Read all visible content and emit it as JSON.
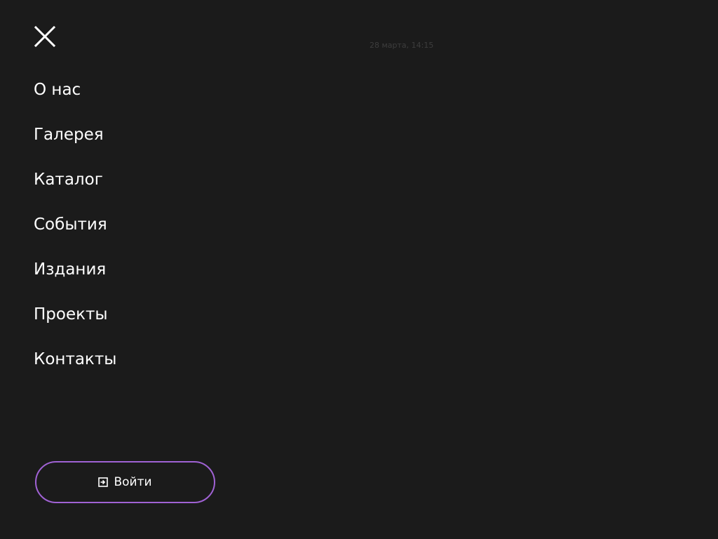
{
  "header": {
    "close_icon": "close-icon",
    "timestamp": "28 марта, 14:15",
    "timestamp_color": "#3d3d3d"
  },
  "menu": {
    "items": [
      {
        "label": "О нас"
      },
      {
        "label": "Галерея"
      },
      {
        "label": "Каталог"
      },
      {
        "label": "События"
      },
      {
        "label": "Издания"
      },
      {
        "label": "Проекты"
      },
      {
        "label": "Контакты"
      }
    ]
  },
  "login": {
    "label": "Войти",
    "icon": "login-icon",
    "border_color": "#a062d4"
  },
  "colors": {
    "background": "#1b1b1b",
    "text": "#ffffff",
    "accent": "#a062d4"
  }
}
